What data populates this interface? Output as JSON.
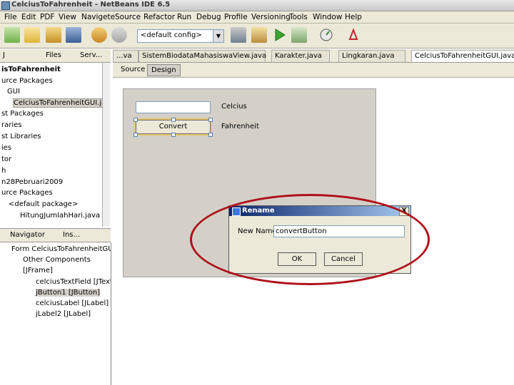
{
  "window": {
    "title": "CelciusToFahrenheit - NetBeans IDE 6.5"
  },
  "menu": [
    "File",
    "Edit",
    "PDF",
    "View",
    "Navigete",
    "Source",
    "Refactor",
    "Run",
    "Debug",
    "Profile",
    "Versioning",
    "Tools",
    "Window",
    "Help"
  ],
  "toolbar": {
    "config_value": "<default config>"
  },
  "project_panel": {
    "tabs": [
      "J",
      "Files",
      "Serv..."
    ],
    "tree": [
      "isToFahrenheit",
      "urce Packages",
      "GUI",
      "CelciusToFahrenheitGUI.ja",
      "st Packages",
      "raries",
      "st Libraries",
      "ies",
      "tor",
      "h",
      "n28Pebruari2009",
      "urce Packages",
      "<default package>",
      "HitungJumlahHari.java"
    ]
  },
  "navigator_panel": {
    "tabs": [
      "Navigator",
      "Ins..."
    ],
    "tree": [
      "Form CelciusToFahrenheitGUI",
      "Other Components",
      "[JFrame]",
      "celciusTextField [JTextFi",
      "jButton1 [JButton]",
      "celciusLabel [JLabel]",
      "jLabel2 [JLabel]"
    ]
  },
  "editor_tabs": [
    "...va",
    "SistemBiodataMahasiswaView.java",
    "Karakter.java",
    "Lingkaran.java",
    "CelciusToFahrenheitGUI.java"
  ],
  "editor_toolbar": {
    "source": "Source",
    "design": "Design"
  },
  "form": {
    "button_label": "Convert",
    "label_celcius": "Celcius",
    "label_fahrenheit": "Fahrenheit"
  },
  "rename_dialog": {
    "title": "Rename",
    "new_name_label": "New Name:",
    "new_name_value": "convertButton",
    "ok": "OK",
    "cancel": "Cancel",
    "close": "X"
  },
  "colors": {
    "annotation_ellipse": "#b0101a",
    "dialog_title_start": "#0a246a"
  }
}
